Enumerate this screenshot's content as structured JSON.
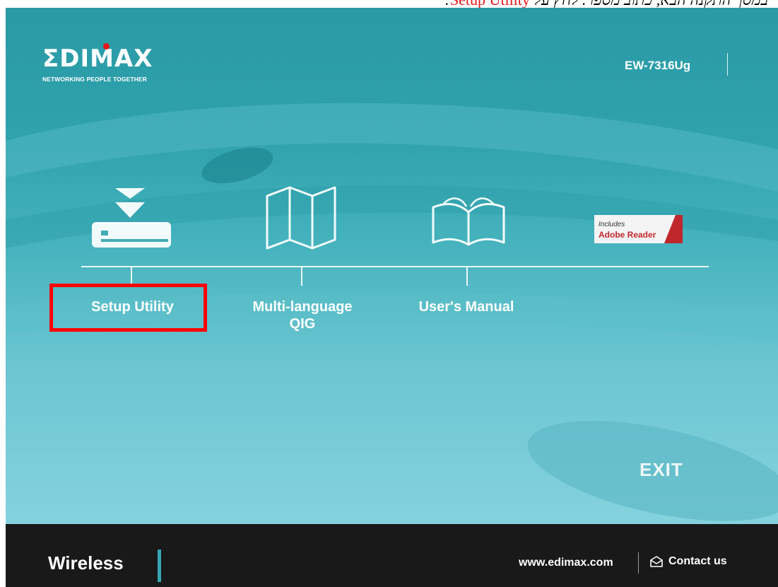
{
  "caption": {
    "prefix": "במסך התקנה הבא, כתוב מספר. לחץ על",
    "highlight": "Setup Utility",
    "suffix": ":"
  },
  "logo": {
    "wordmark": "ΣDIMAX",
    "tagline": "NETWORKING PEOPLE TOGETHER"
  },
  "model": "EW-7316Ug",
  "menu": {
    "setup_utility": "Setup Utility",
    "multi_language_line1": "Multi-language",
    "multi_language_line2": "QIG",
    "users_manual": "User's Manual",
    "adobe_line1": "Includes",
    "adobe_line2": "Adobe Reader"
  },
  "exit_label": "EXIT",
  "footer": {
    "wireless": "Wireless",
    "url": "www.edimax.com",
    "contact": "Contact us"
  },
  "colors": {
    "highlight": "#ff0000",
    "accent": "#37a5b2",
    "background_top": "#2a9aa5",
    "background_bottom": "#84d2de",
    "footer": "#191919"
  }
}
